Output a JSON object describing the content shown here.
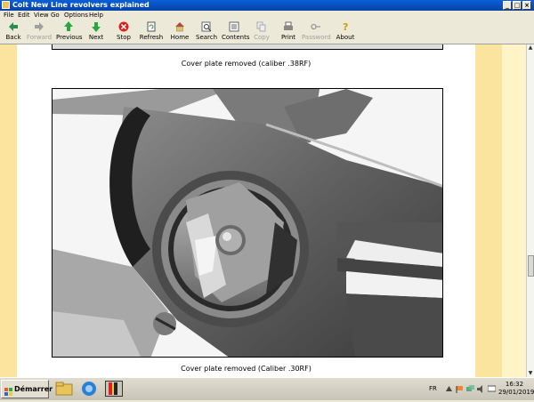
{
  "window": {
    "title": "Colt New Line revolvers explained"
  },
  "menu": [
    "File",
    "Edit",
    "View",
    "Go",
    "Options",
    "Help"
  ],
  "toolbar": {
    "buttons": [
      {
        "label": "Back",
        "icon": "back-arrow-icon",
        "enabled": true
      },
      {
        "label": "Forward",
        "icon": "forward-arrow-icon",
        "enabled": false
      },
      {
        "label": "Previous",
        "icon": "up-arrow-icon",
        "enabled": true
      },
      {
        "label": "Next",
        "icon": "down-arrow-icon",
        "enabled": true
      },
      {
        "label": "Stop",
        "icon": "stop-icon",
        "enabled": true
      },
      {
        "label": "Refresh",
        "icon": "refresh-icon",
        "enabled": true
      },
      {
        "label": "Home",
        "icon": "home-icon",
        "enabled": true
      },
      {
        "label": "Search",
        "icon": "search-icon",
        "enabled": true
      },
      {
        "label": "Contents",
        "icon": "contents-icon",
        "enabled": true
      },
      {
        "label": "Copy",
        "icon": "copy-icon",
        "enabled": false
      },
      {
        "label": "Print",
        "icon": "print-icon",
        "enabled": true
      },
      {
        "label": "Password",
        "icon": "key-icon",
        "enabled": false
      },
      {
        "label": "About",
        "icon": "about-icon",
        "enabled": true
      }
    ]
  },
  "content": {
    "captions": [
      "Cover plate removed (caliber .38RF)",
      "Cover plate removed (Caliber .30RF)"
    ]
  },
  "taskbar": {
    "start_label": "Démarrer",
    "language": "FR",
    "time": "16:32",
    "date": "29/01/2019"
  },
  "colors": {
    "page_background": "#fbe49e",
    "title_bar": "#0842a8"
  }
}
